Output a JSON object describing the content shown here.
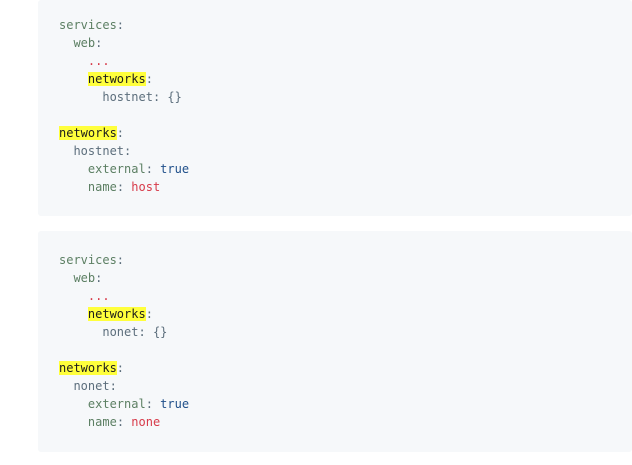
{
  "blocks": [
    {
      "services_key": "services",
      "web_key": "web",
      "ellipsis": "...",
      "networks_key": "networks",
      "inner_net_key": "hostnet",
      "inner_net_value": "{}",
      "top_networks_key": "networks",
      "net_key": "hostnet",
      "external_key": "external",
      "external_value": "true",
      "name_key": "name",
      "name_value": "host",
      "colon": ":"
    },
    {
      "services_key": "services",
      "web_key": "web",
      "ellipsis": "...",
      "networks_key": "networks",
      "inner_net_key": "nonet",
      "inner_net_value": "{}",
      "top_networks_key": "networks",
      "net_key": "nonet",
      "external_key": "external",
      "external_value": "true",
      "name_key": "name",
      "name_value": "none",
      "colon": ":"
    }
  ],
  "colors": {
    "highlight": "#ffff3c",
    "code_background": "#f6f8fa",
    "string": "#d73a49",
    "boolean": "#1f4f8a"
  }
}
